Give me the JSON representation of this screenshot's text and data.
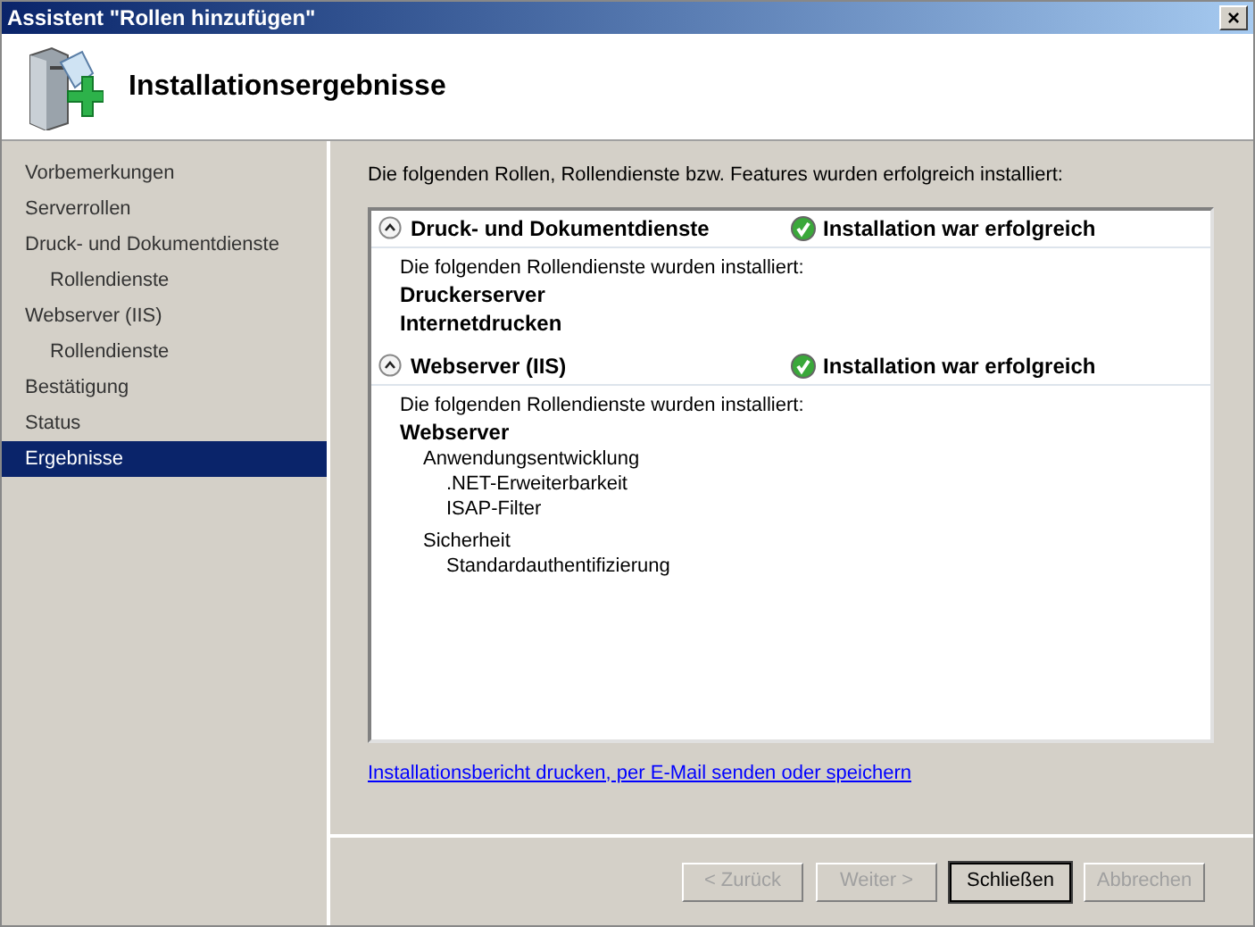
{
  "window": {
    "title": "Assistent \"Rollen hinzufügen\"",
    "close": "×"
  },
  "header": {
    "title": "Installationsergebnisse"
  },
  "sidebar": {
    "items": [
      {
        "label": "Vorbemerkungen",
        "selected": false
      },
      {
        "label": "Serverrollen",
        "selected": false
      },
      {
        "label": "Druck- und Dokumentdienste",
        "selected": false,
        "children": [
          {
            "label": "Rollendienste",
            "selected": false
          }
        ]
      },
      {
        "label": "Webserver (IIS)",
        "selected": false,
        "children": [
          {
            "label": "Rollendienste",
            "selected": false
          }
        ]
      },
      {
        "label": "Bestätigung",
        "selected": false
      },
      {
        "label": "Status",
        "selected": false
      },
      {
        "label": "Ergebnisse",
        "selected": true
      }
    ]
  },
  "intro": "Die folgenden Rollen, Rollendienste bzw. Features wurden erfolgreich installiert:",
  "results": [
    {
      "title": "Druck- und Dokumentdienste",
      "expanded": true,
      "status": "Installation war erfolgreich",
      "note": "Die folgenden Rollendienste wurden installiert:",
      "items": [
        {
          "label": "Druckerserver"
        },
        {
          "label": "Internetdrucken"
        }
      ]
    },
    {
      "title": "Webserver (IIS)",
      "expanded": true,
      "status": "Installation war erfolgreich",
      "note": "Die folgenden Rollendienste wurden installiert:",
      "items": [
        {
          "label": "Webserver",
          "children": [
            {
              "label": "Anwendungsentwicklung",
              "children": [
                {
                  "label": ".NET-Erweiterbarkeit"
                },
                {
                  "label": "ISAP-Filter"
                }
              ]
            },
            {
              "label": "Sicherheit",
              "children": [
                {
                  "label": "Standardauthentifizierung"
                }
              ]
            }
          ]
        }
      ]
    }
  ],
  "link": "Installationsbericht drucken, per E-Mail senden oder speichern",
  "buttons": [
    {
      "label": "< Zurück",
      "disabled": true,
      "default": false
    },
    {
      "label": "Weiter >",
      "disabled": true,
      "default": false
    },
    {
      "label": "Schließen",
      "disabled": false,
      "default": true
    },
    {
      "label": "Abbrechen",
      "disabled": true,
      "default": false
    }
  ]
}
